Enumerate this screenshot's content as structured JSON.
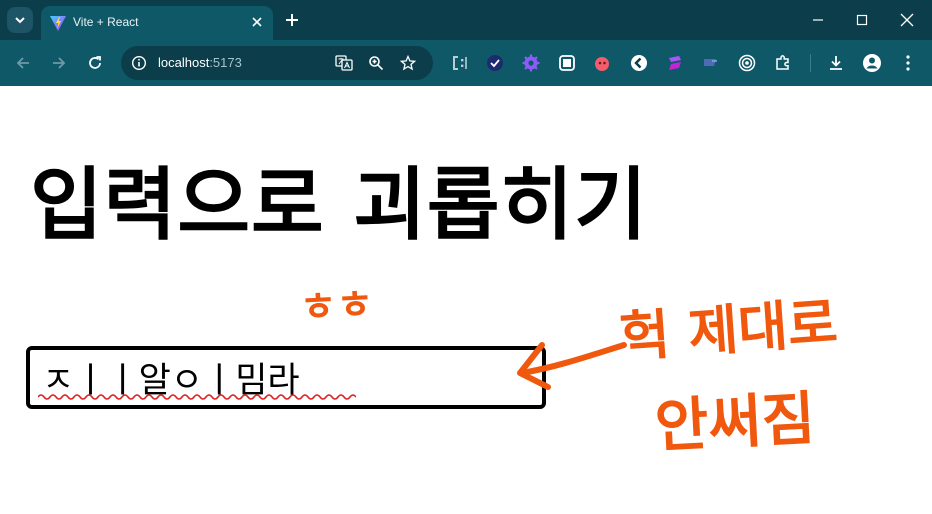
{
  "browser": {
    "tab": {
      "title": "Vite + React"
    },
    "address_bar": {
      "host": "localhost",
      "port": ":5173"
    },
    "accent_color": "#0f5868",
    "tabbar_color": "#0b3d4b"
  },
  "page": {
    "title": "입력으로 괴롭히기",
    "input": {
      "value": "ㅈㅣㅣ알ㅇㅣ밈라"
    }
  },
  "annotations": {
    "emoticon": "ㅎㅎ",
    "note_line1": "헉 제대로",
    "note_line2": "안써짐",
    "color": "#f0580e"
  },
  "icons": {
    "tab_menu": "chevron-down-icon",
    "favicon": "vite-logo-icon",
    "tab_close": "close-icon",
    "new_tab": "plus-icon",
    "minimize": "minimize-icon",
    "maximize": "maximize-icon",
    "close_window": "close-icon",
    "back": "back-arrow-icon",
    "forward": "forward-arrow-icon",
    "reload": "reload-icon",
    "site_info": "info-icon",
    "translate": "translate-icon",
    "zoom": "zoom-icon",
    "bookmark": "star-icon",
    "extensions": "puzzle-icon",
    "downloads": "download-icon",
    "profile": "avatar-icon",
    "menu": "kebab-menu-icon"
  }
}
